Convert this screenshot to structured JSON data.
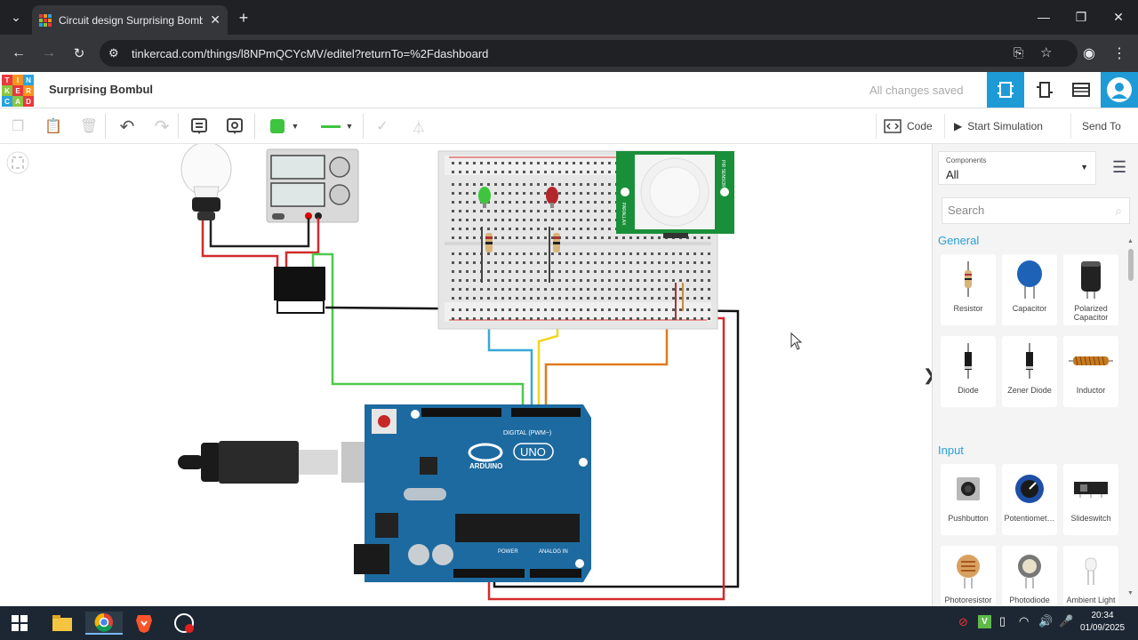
{
  "browser": {
    "tab_title": "Circuit design Surprising Bombu",
    "url": "tinkercad.com/things/l8NPmQCYcMV/editel?returnTo=%2Fdashboard"
  },
  "app": {
    "logo_letters": [
      "T",
      "I",
      "N",
      "K",
      "E",
      "R",
      "C",
      "A",
      "D"
    ],
    "doc_name": "Surprising Bombul",
    "save_status": "All changes saved"
  },
  "toolbar": {
    "code_label": "Code",
    "start_sim_label": "Start Simulation",
    "send_to_label": "Send To",
    "wire_color": "#3ec43e"
  },
  "canvas": {
    "arduino_brand": "ARDUINO",
    "arduino_model": "UNO",
    "digital_label": "DIGITAL (PWM~)",
    "power_label": "POWER",
    "analog_label": "ANALOG IN",
    "pir_label_1": "PIR SENSOR",
    "pir_label_2": "PARALLAX"
  },
  "panel": {
    "components_small": "Components",
    "components_value": "All",
    "search_placeholder": "Search",
    "general_heading": "General",
    "input_heading": "Input",
    "general_items": [
      {
        "label": "Resistor",
        "icon": "resistor-icon"
      },
      {
        "label": "Capacitor",
        "icon": "capacitor-icon"
      },
      {
        "label": "Polarized Capacitor",
        "icon": "polarized-capacitor-icon"
      },
      {
        "label": "Diode",
        "icon": "diode-icon"
      },
      {
        "label": "Zener Diode",
        "icon": "zener-diode-icon"
      },
      {
        "label": "Inductor",
        "icon": "inductor-icon"
      }
    ],
    "input_items": [
      {
        "label": "Pushbutton",
        "icon": "pushbutton-icon"
      },
      {
        "label": "Potentiomet…",
        "icon": "potentiometer-icon"
      },
      {
        "label": "Slideswitch",
        "icon": "slideswitch-icon"
      },
      {
        "label": "Photoresistor",
        "icon": "photoresistor-icon"
      },
      {
        "label": "Photodiode",
        "icon": "photodiode-icon"
      },
      {
        "label": "Ambient Light",
        "icon": "ambient-light-icon"
      }
    ]
  },
  "taskbar": {
    "time": "20:34",
    "date": "01/09/2025"
  }
}
